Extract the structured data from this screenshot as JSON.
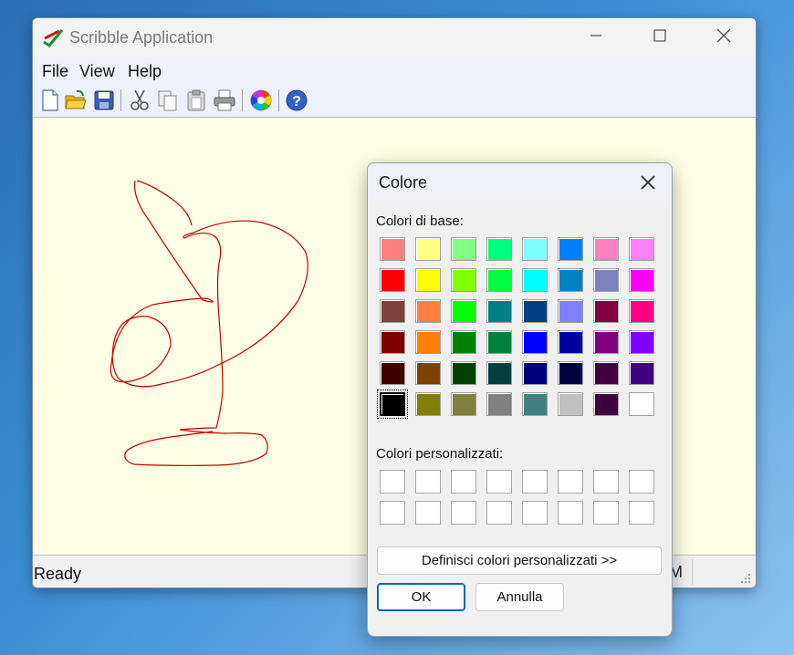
{
  "window": {
    "title": "Scribble Application",
    "controls": [
      "minimize",
      "maximize",
      "close"
    ]
  },
  "menu": [
    "File",
    "View",
    "Help"
  ],
  "toolbar": [
    "new-file-icon",
    "open-folder-icon",
    "save-icon",
    "cut-icon",
    "copy-icon",
    "paste-icon",
    "print-icon",
    "color-wheel-icon",
    "help-icon"
  ],
  "canvas": {
    "background": "#ffffe6",
    "stroke_color": "#cc0000"
  },
  "status": {
    "text": "Ready",
    "right": "M"
  },
  "dialog": {
    "title": "Colore",
    "basic_label": "Colori di base:",
    "custom_label": "Colori personalizzati:",
    "define_button": "Definisci colori personalizzati >>",
    "ok_button": "OK",
    "cancel_button": "Annulla",
    "basic_colors": [
      [
        "#ff8080",
        "#ffff80",
        "#80ff80",
        "#00ff80",
        "#80ffff",
        "#0080ff",
        "#ff80c0",
        "#ff80ff"
      ],
      [
        "#ff0000",
        "#ffff00",
        "#80ff00",
        "#00ff40",
        "#00ffff",
        "#0080c0",
        "#8080c0",
        "#ff00ff"
      ],
      [
        "#804040",
        "#ff8040",
        "#00ff00",
        "#008080",
        "#004080",
        "#8080ff",
        "#800040",
        "#ff0080"
      ],
      [
        "#800000",
        "#ff8000",
        "#008000",
        "#008040",
        "#0000ff",
        "#0000a0",
        "#800080",
        "#8000ff"
      ],
      [
        "#400000",
        "#804000",
        "#004000",
        "#004040",
        "#000080",
        "#000040",
        "#400040",
        "#400080"
      ],
      [
        "#000000",
        "#808000",
        "#808040",
        "#808080",
        "#408080",
        "#c0c0c0",
        "#400040",
        "#ffffff"
      ]
    ],
    "selected_color": "#000000"
  }
}
